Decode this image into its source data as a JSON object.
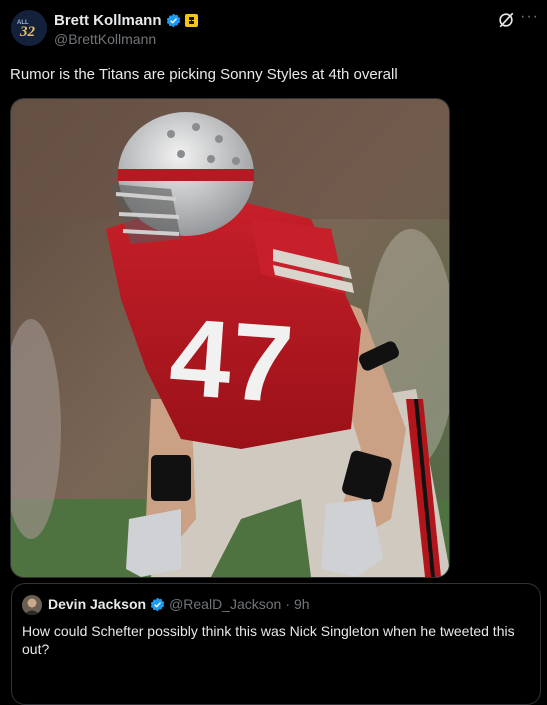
{
  "author": {
    "display_name": "Brett Kollmann",
    "handle": "@BrettKollmann",
    "avatar_text": "32"
  },
  "tweet": {
    "text": "Rumor is the Titans are picking Sonny Styles at 4th overall",
    "image": {
      "jersey_number": "47"
    }
  },
  "quoted": {
    "display_name": "Devin Jackson",
    "handle": "@RealD_Jackson",
    "separator": "·",
    "time": "9h",
    "text": "How could Schefter possibly think this was Nick Singleton when he tweeted this out?"
  },
  "icons": {
    "verified": "verified-badge-icon",
    "affiliate": "affiliate-badge-icon",
    "grok": "grok-icon",
    "more": "more-options-icon"
  },
  "colors": {
    "background": "#000000",
    "text": "#e7e9ea",
    "muted": "#71767b",
    "verified": "#1d9bf0",
    "border": "#2f3336",
    "jersey_red": "#b3151c"
  }
}
